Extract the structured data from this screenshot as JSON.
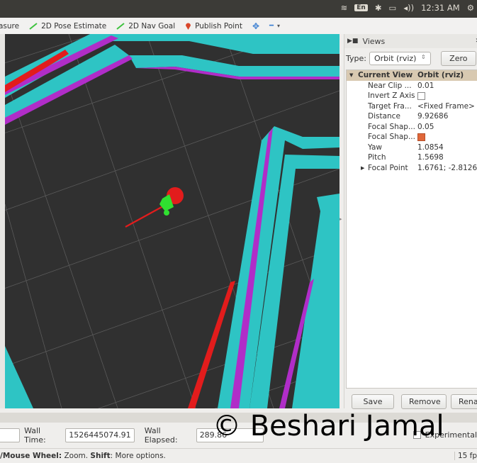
{
  "system_tray": {
    "keyboard": "En",
    "bluetooth": "✱",
    "battery": "▭",
    "volume": "◂))",
    "clock": "12:31 AM",
    "settings": "⚙"
  },
  "toolbar": {
    "measure": "asure",
    "pose_estimate": "2D Pose Estimate",
    "nav_goal": "2D Nav Goal",
    "publish_point": "Publish Point",
    "plus": "✥",
    "minus": "━"
  },
  "views_panel": {
    "title": "Views",
    "close": "✕",
    "type_label": "Type:",
    "type_value": "Orbit (rviz)",
    "zero_button": "Zero",
    "header": {
      "name": "Current View",
      "value": "Orbit (rviz)"
    },
    "props": [
      {
        "name": "Near Clip ...",
        "value": "0.01"
      },
      {
        "name": "Invert Z Axis",
        "value": ""
      },
      {
        "name": "Target Fra...",
        "value": "<Fixed Frame>"
      },
      {
        "name": "Distance",
        "value": "9.92686"
      },
      {
        "name": "Focal Shap...",
        "value": "0.05"
      },
      {
        "name": "Focal Shap...",
        "value": ""
      },
      {
        "name": "Yaw",
        "value": "1.0854"
      },
      {
        "name": "Pitch",
        "value": "1.5698"
      },
      {
        "name": "Focal Point",
        "value": "1.6761; -2.8126; ..."
      }
    ],
    "save_button": "Save",
    "remove_button": "Remove",
    "rename_button": "Rename"
  },
  "time_panel": {
    "wall_time_label": "Wall Time:",
    "wall_time_value": "1526445074.91",
    "wall_elapsed_label": "Wall Elapsed:",
    "wall_elapsed_value": "289.86",
    "experimental_label": "Experimental"
  },
  "status": {
    "hint_a": "/Mouse Wheel:",
    "hint_b": " Zoom. ",
    "hint_c": "Shift",
    "hint_d": ": More options.",
    "fps": "15 fp"
  },
  "watermark": "© Beshari Jamal",
  "colors": {
    "map_free": "#2ec4c4",
    "map_wall": "#b02dc8",
    "path": "#e21c1c",
    "particles": "#30e030",
    "grid_bg": "#303030"
  }
}
